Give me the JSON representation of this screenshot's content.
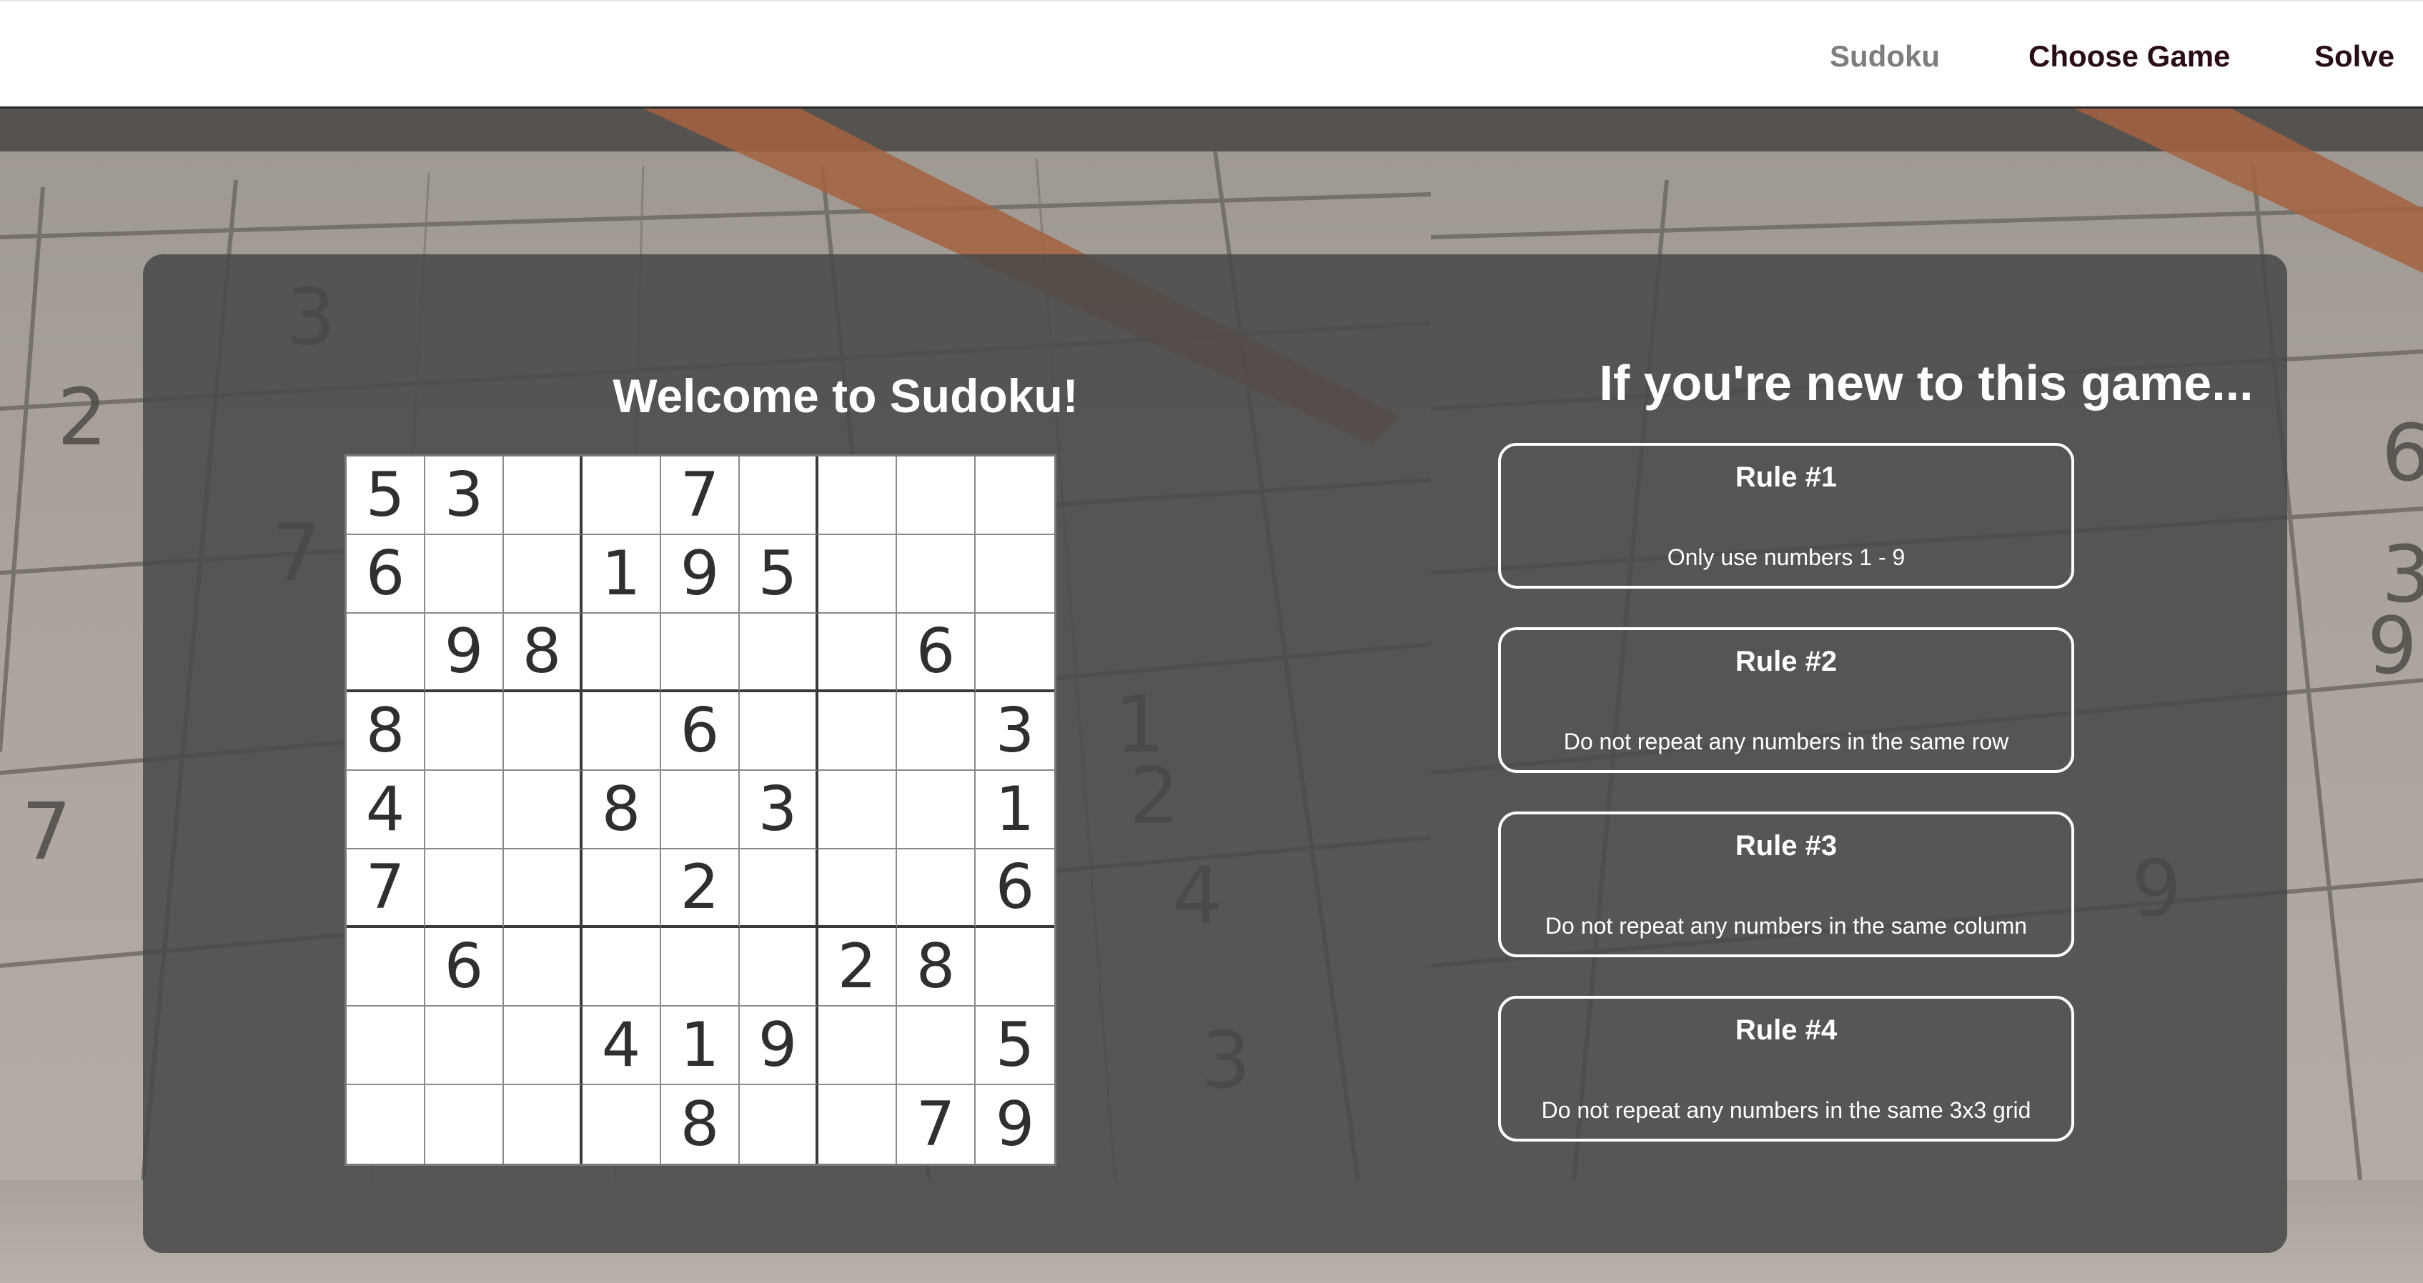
{
  "nav": {
    "items": [
      {
        "label": "Sudoku"
      },
      {
        "label": "Choose Game"
      },
      {
        "label": "Solve"
      }
    ]
  },
  "welcome": {
    "title": "Welcome to Sudoku!"
  },
  "board": {
    "grid": [
      [
        "5",
        "3",
        "",
        "",
        "7",
        "",
        "",
        "",
        ""
      ],
      [
        "6",
        "",
        "",
        "1",
        "9",
        "5",
        "",
        "",
        ""
      ],
      [
        "",
        "9",
        "8",
        "",
        "",
        "",
        "",
        "6",
        ""
      ],
      [
        "8",
        "",
        "",
        "",
        "6",
        "",
        "",
        "",
        "3"
      ],
      [
        "4",
        "",
        "",
        "8",
        "",
        "3",
        "",
        "",
        "1"
      ],
      [
        "7",
        "",
        "",
        "",
        "2",
        "",
        "",
        "",
        "6"
      ],
      [
        "",
        "6",
        "",
        "",
        "",
        "",
        "2",
        "8",
        ""
      ],
      [
        "",
        "",
        "",
        "4",
        "1",
        "9",
        "",
        "",
        "5"
      ],
      [
        "",
        "",
        "",
        "",
        "8",
        "",
        "",
        "7",
        "9"
      ]
    ]
  },
  "rules": {
    "title": "If you're new to this game...",
    "items": [
      {
        "title": "Rule #1",
        "text": "Only use numbers 1 - 9"
      },
      {
        "title": "Rule #2",
        "text": "Do not repeat any numbers in the same row"
      },
      {
        "title": "Rule #3",
        "text": "Do not repeat any numbers in the same column"
      },
      {
        "title": "Rule #4",
        "text": "Do not repeat any numbers in the same 3x3 grid"
      }
    ]
  },
  "colors": {
    "panel": "#484848",
    "nav_active": "#7d7d7d",
    "nav_text": "#2a0d1a"
  }
}
